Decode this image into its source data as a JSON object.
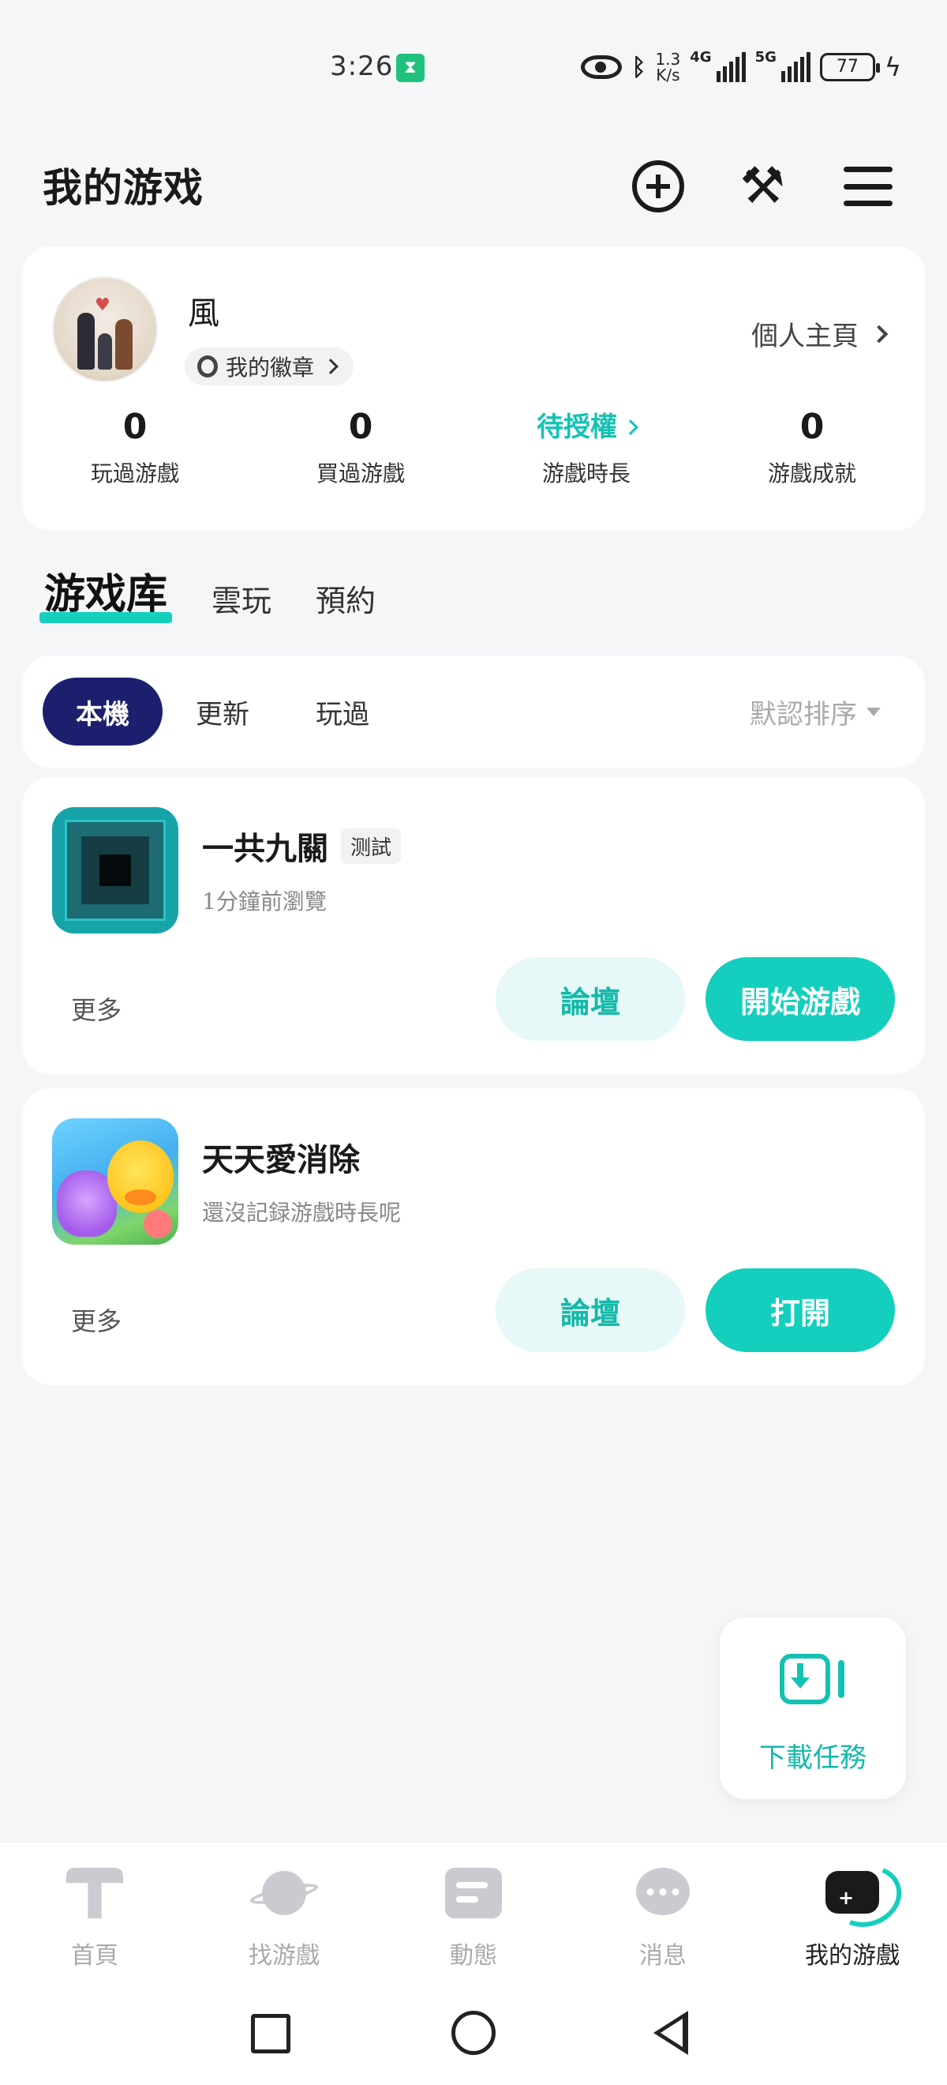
{
  "status_bar": {
    "time": "3:26",
    "timer_icon": "hourglass-icon",
    "net_speed_value": "1.3",
    "net_speed_unit": "K/s",
    "signal_1_label": "4G",
    "signal_2_label": "5G",
    "battery": "77"
  },
  "header": {
    "title": "我的游戏",
    "icons": [
      "add-circle-icon",
      "tools-icon",
      "menu-icon"
    ]
  },
  "profile": {
    "username": "風",
    "badge_label": "我的徽章",
    "homepage_label": "個人主頁",
    "stats": [
      {
        "value": "0",
        "label": "玩過游戲"
      },
      {
        "value": "0",
        "label": "買過游戲"
      },
      {
        "value": "待授權",
        "label": "游戲時長"
      },
      {
        "value": "0",
        "label": "游戲成就"
      }
    ]
  },
  "tabs": {
    "items": [
      "游戏库",
      "雲玩",
      "預約"
    ],
    "active": "游戏库"
  },
  "filters": {
    "chips": [
      "本機",
      "更新",
      "玩過"
    ],
    "active": "本機",
    "sort_label": "默認排序"
  },
  "games": [
    {
      "title": "一共九關",
      "tag": "测試",
      "subtitle": "1分鐘前瀏覽",
      "more_label": "更多",
      "forum_label": "論壇",
      "action_label": "開始游戲"
    },
    {
      "title": "天天愛消除",
      "tag": "",
      "subtitle": "還沒記録游戲時長呢",
      "more_label": "更多",
      "forum_label": "論壇",
      "action_label": "打開"
    }
  ],
  "download_task": {
    "label": "下載任務"
  },
  "bottom_nav": {
    "items": [
      "首頁",
      "找游戲",
      "動態",
      "消息",
      "我的游戲"
    ],
    "active": "我的游戲"
  },
  "colors": {
    "accent": "#14cfbd",
    "accent_text": "#14b9a9",
    "chip_active": "#1c1f6e",
    "background": "#f5f6f8"
  }
}
